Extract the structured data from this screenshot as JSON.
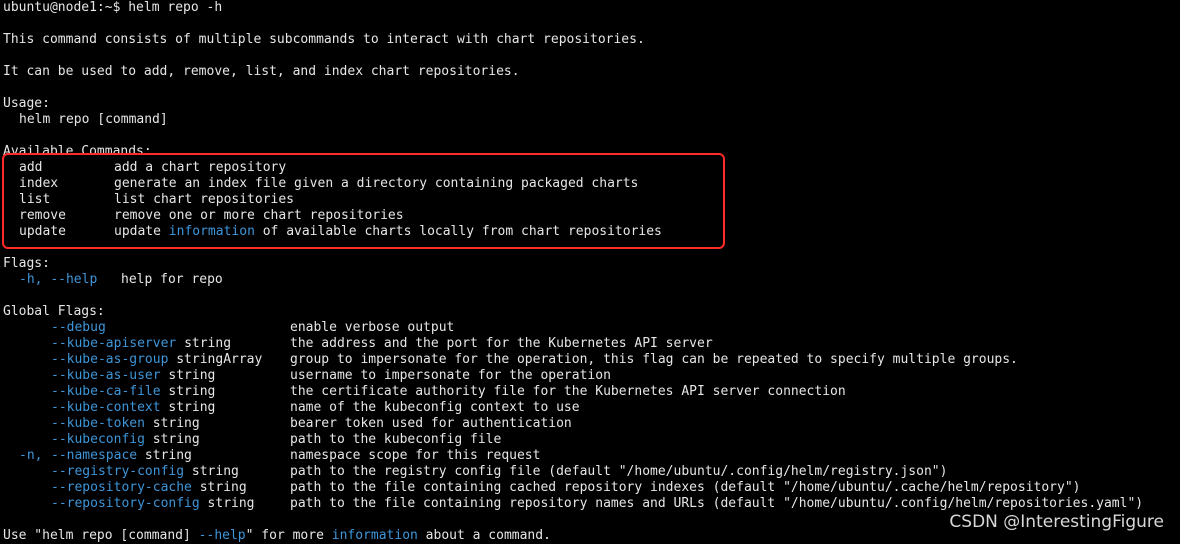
{
  "prompt": {
    "user_host": "ubuntu@node1:~$",
    "command": "helm repo -h"
  },
  "intro": [
    "This command consists of multiple subcommands to interact with chart repositories.",
    "It can be used to add, remove, list, and index chart repositories."
  ],
  "usage": {
    "header": "Usage:",
    "line": "helm repo [command]"
  },
  "available_commands": {
    "header": "Available Commands:",
    "items": [
      {
        "name": "add",
        "desc": "add a chart repository"
      },
      {
        "name": "index",
        "desc": "generate an index file given a directory containing packaged charts"
      },
      {
        "name": "list",
        "desc": "list chart repositories"
      },
      {
        "name": "remove",
        "desc": "remove one or more chart repositories"
      },
      {
        "name": "update",
        "desc_pre": "update",
        "desc_link": "information",
        "desc_post": "of available charts locally from chart repositories"
      }
    ]
  },
  "flags": {
    "header": "Flags:",
    "short": "-h,",
    "long": "--help",
    "desc": "help for repo"
  },
  "global_flags": {
    "header": "Global Flags:",
    "items": [
      {
        "short": "",
        "flag": "--debug",
        "type": "",
        "desc": "enable verbose output"
      },
      {
        "short": "",
        "flag": "--kube-apiserver",
        "type": "string",
        "desc": "the address and the port for the Kubernetes API server"
      },
      {
        "short": "",
        "flag": "--kube-as-group",
        "type": "stringArray",
        "desc": "group to impersonate for the operation, this flag can be repeated to specify multiple groups."
      },
      {
        "short": "",
        "flag": "--kube-as-user",
        "type": "string",
        "desc": "username to impersonate for the operation"
      },
      {
        "short": "",
        "flag": "--kube-ca-file",
        "type": "string",
        "desc": "the certificate authority file for the Kubernetes API server connection"
      },
      {
        "short": "",
        "flag": "--kube-context",
        "type": "string",
        "desc": "name of the kubeconfig context to use"
      },
      {
        "short": "",
        "flag": "--kube-token",
        "type": "string",
        "desc": "bearer token used for authentication"
      },
      {
        "short": "",
        "flag": "--kubeconfig",
        "type": "string",
        "desc": "path to the kubeconfig file"
      },
      {
        "short": "-n,",
        "flag": "--namespace",
        "type": "string",
        "desc": "namespace scope for this request"
      },
      {
        "short": "",
        "flag": "--registry-config",
        "type": "string",
        "desc": "path to the registry config file (default \"/home/ubuntu/.config/helm/registry.json\")"
      },
      {
        "short": "",
        "flag": "--repository-cache",
        "type": "string",
        "desc": "path to the file containing cached repository indexes (default \"/home/ubuntu/.cache/helm/repository\")"
      },
      {
        "short": "",
        "flag": "--repository-config",
        "type": "string",
        "desc": "path to the file containing repository names and URLs (default \"/home/ubuntu/.config/helm/repositories.yaml\")"
      }
    ]
  },
  "footer": {
    "pre": "Use \"helm repo [command]",
    "flag": "--help",
    "mid": "\" for more",
    "link": "information",
    "post": "about a command."
  },
  "watermark": "CSDN @InterestingFigure",
  "colors": {
    "background": "#000000",
    "text": "#e6e6e6",
    "accent": "#3e95d8",
    "highlight_box": "#ff2a2a"
  }
}
